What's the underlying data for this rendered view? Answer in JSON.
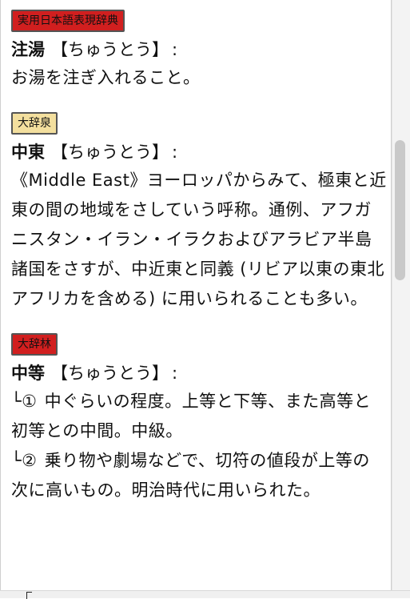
{
  "entries": [
    {
      "source": "実用日本語表現辞典",
      "source_color": "#d11f1f",
      "headword": "注湯",
      "reading": "【ちゅうとう】",
      "colon": ":",
      "definition": "お湯を注ぎ入れること。"
    },
    {
      "source": "大辞泉",
      "source_color": "#f3df9e",
      "headword": "中東",
      "reading": "【ちゅうとう】",
      "colon": ":",
      "definition": "《Middle East》ヨーロッパからみて、極東と近東の間の地域をさしていう呼称。通例、アフガニスタン・イラン・イラクおよびアラビア半島諸国をさすが、中近東と同義 (リビア以東の東北アフリカを含める) に用いられることも多い。"
    },
    {
      "source": "大辞林",
      "source_color": "#d11f1f",
      "headword": "中等",
      "reading": "【ちゅうとう】",
      "colon": ":",
      "senses": [
        {
          "marker": "└①",
          "text": " 中ぐらいの程度。上等と下等、また高等と初等との中間。中級。"
        },
        {
          "marker": "└②",
          "text": " 乗り物や劇場などで、切符の値段が上等の次に高いもの。明治時代に用いられた。"
        }
      ]
    }
  ]
}
